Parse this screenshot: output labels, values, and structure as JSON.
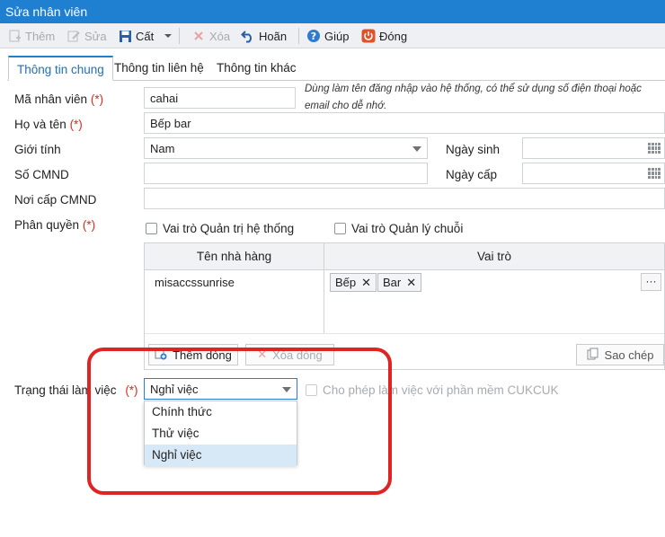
{
  "window": {
    "title": "Sửa nhân viên"
  },
  "toolbar": {
    "add": "Thêm",
    "edit": "Sửa",
    "save": "Cất",
    "delete": "Xóa",
    "undo": "Hoãn",
    "help": "Giúp",
    "close": "Đóng"
  },
  "tabs": [
    "Thông tin chung",
    "Thông tin liên hệ",
    "Thông tin khác"
  ],
  "form": {
    "required_mark": "(*)",
    "employee_code_label": "Mã nhân viên",
    "employee_code_value": "cahai",
    "employee_code_hint": "Dùng làm tên đăng nhập vào hệ thống, có thể sử dụng số điện thoại hoặc email cho dễ nhớ.",
    "full_name_label": "Họ và tên",
    "full_name_value": "Bếp bar",
    "gender_label": "Giới tính",
    "gender_value": "Nam",
    "birth_date_label": "Ngày sinh",
    "birth_date_value": "",
    "id_number_label": "Số CMND",
    "id_number_value": "",
    "issue_date_label": "Ngày cấp",
    "issue_date_value": "",
    "issue_place_label": "Nơi cấp CMND",
    "issue_place_value": "",
    "permission_label": "Phân quyền",
    "role_admin_label": "Vai trò Quản trị hệ thống",
    "role_chain_label": "Vai trò Quản lý chuỗi",
    "work_status_label": "Trạng thái làm việc",
    "work_status_value": "Nghỉ việc",
    "allow_cukcuk_label": "Cho phép làm việc với phần mềm CUKCUK"
  },
  "grid": {
    "columns": [
      "Tên nhà hàng",
      "Vai trò"
    ],
    "rows": [
      {
        "restaurant": "misaccssunrise",
        "roles": [
          "Bếp",
          "Bar"
        ]
      }
    ],
    "add_row": "Thêm dòng",
    "delete_row": "Xóa dòng",
    "copy": "Sao chép",
    "more": "···"
  },
  "dropdown": {
    "options": [
      "Chính thức",
      "Thử việc",
      "Nghỉ việc"
    ],
    "selected_index": 2
  },
  "colors": {
    "titlebar": "#1f7fd0",
    "required": "#e0281e",
    "highlight": "#e02424",
    "selected_option": "#d7e8f7"
  }
}
